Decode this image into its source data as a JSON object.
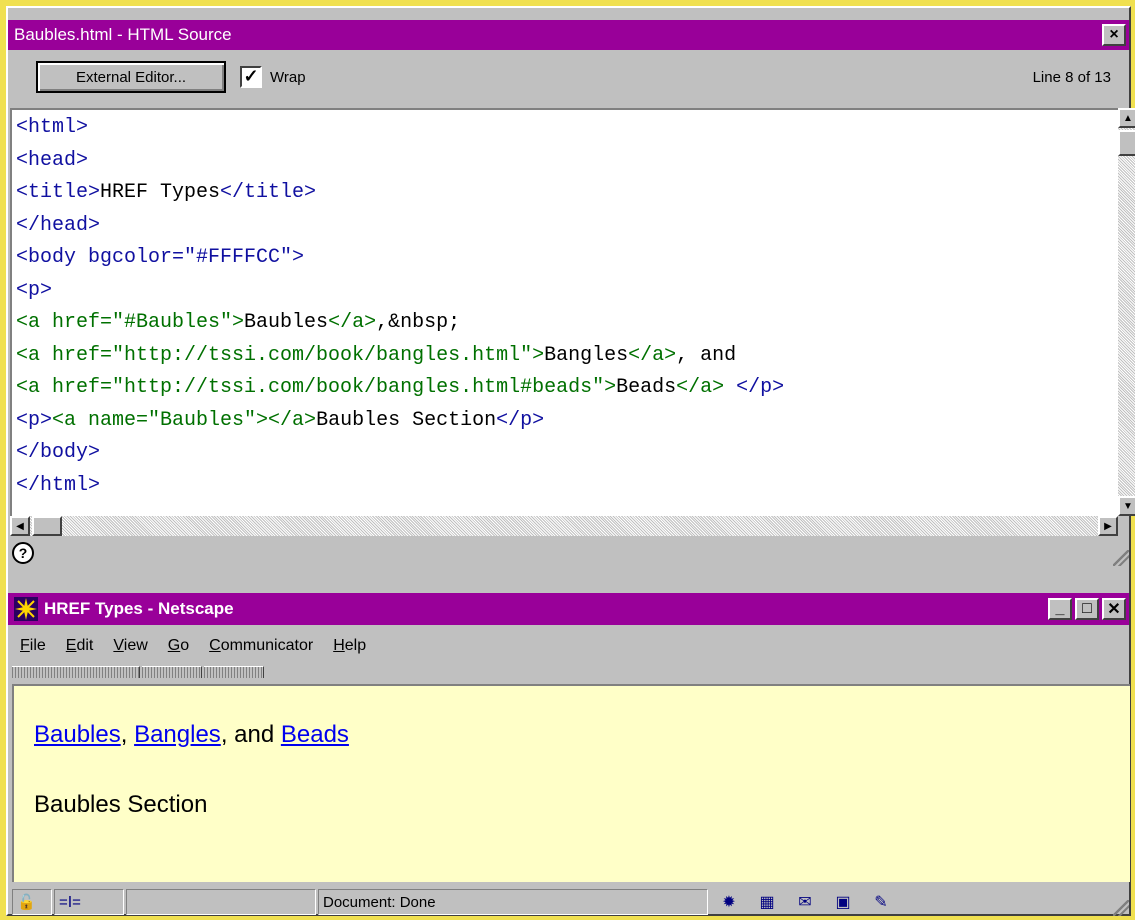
{
  "editor": {
    "title": "Baubles.html - HTML Source",
    "close_icon": "×",
    "external_editor_label": "External Editor...",
    "wrap_checked": true,
    "wrap_label": "Wrap",
    "line_info": "Line 8 of 13",
    "code_lines": [
      [
        [
          "tag",
          "<html>"
        ]
      ],
      [
        [
          "tag",
          "<head>"
        ]
      ],
      [
        [
          "tag",
          "<title>"
        ],
        [
          "txt",
          "HREF Types"
        ],
        [
          "tag",
          "</title>"
        ]
      ],
      [
        [
          "tag",
          "</head>"
        ]
      ],
      [
        [
          "tag",
          "<body bgcolor=\"#FFFFCC\">"
        ]
      ],
      [
        [
          "tag",
          "<p>"
        ]
      ],
      [
        [
          "attr",
          "<a href=\"#Baubles\">"
        ],
        [
          "txt",
          "Baubles"
        ],
        [
          "attr",
          "</a>"
        ],
        [
          "txt",
          ",&nbsp;"
        ]
      ],
      [
        [
          "attr",
          "<a href=\"http://tssi.com/book/bangles.html\">"
        ],
        [
          "txt",
          "Bangles"
        ],
        [
          "attr",
          "</a>"
        ],
        [
          "txt",
          ", and"
        ]
      ],
      [
        [
          "attr",
          "<a href=\"http://tssi.com/book/bangles.html#beads\">"
        ],
        [
          "txt",
          "Beads"
        ],
        [
          "attr",
          "</a>"
        ],
        [
          "txt",
          " "
        ],
        [
          "tag",
          "</p>"
        ]
      ],
      [
        [
          "tag",
          "<p>"
        ],
        [
          "attr",
          "<a name=\"Baubles\"></a>"
        ],
        [
          "txt",
          "Baubles Section"
        ],
        [
          "tag",
          "</p>"
        ]
      ],
      [
        [
          "tag",
          "</body>"
        ]
      ],
      [
        [
          "tag",
          "</html>"
        ]
      ]
    ]
  },
  "browser": {
    "title": "HREF Types - Netscape",
    "menu": [
      "File",
      "Edit",
      "View",
      "Go",
      "Communicator",
      "Help"
    ],
    "page": {
      "link1": "Baubles",
      "sep1": ", ",
      "link2": "Bangles",
      "sep2": ", and ",
      "link3": "Beads",
      "section": "Baubles Section"
    },
    "status": "Document: Done"
  },
  "colors": {
    "titlebar": "#990099",
    "page_bg": "#ffffc8",
    "link": "#0000ee",
    "tag": "#1010a0",
    "attr": "#007000"
  }
}
